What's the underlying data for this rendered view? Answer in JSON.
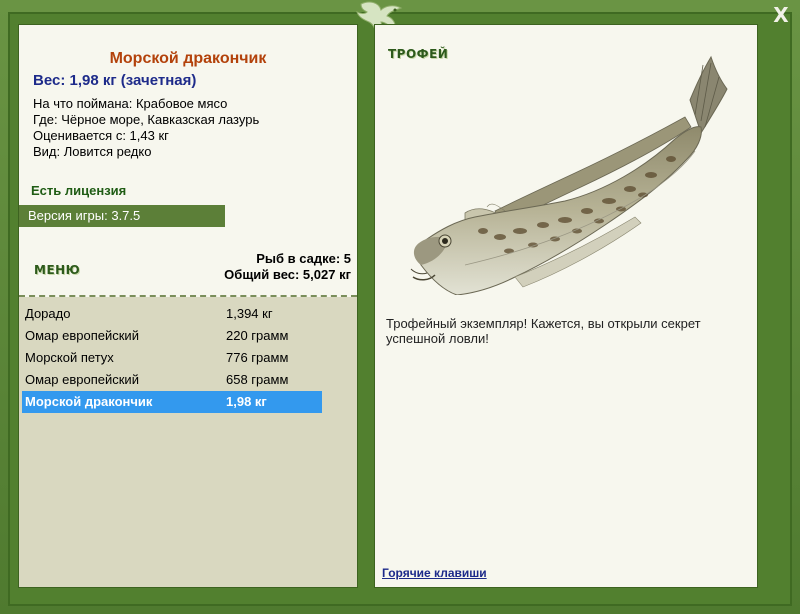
{
  "window": {
    "close_label": "X"
  },
  "fish": {
    "title": "Морской дракончик",
    "weight_line": "Вес: 1,98 кг (зачетная)",
    "bait_line": "На что поймана: Крабовое мясо",
    "location_line": "Где: Чёрное море, Кавказская лазурь",
    "rating_line": "Оценивается с: 1,43 кг",
    "rarity_line": "Вид: Ловится редко"
  },
  "status": {
    "license": "Есть лицензия",
    "version": "Версия игры: 3.7.5"
  },
  "menu": {
    "label": "МЕНЮ"
  },
  "cage": {
    "count_line": "Рыб в садке: 5",
    "total_line": "Общий вес: 5,027 кг"
  },
  "catch_list": [
    {
      "name": "Дорадо",
      "weight": "1,394 кг"
    },
    {
      "name": "Омар европейский",
      "weight": "220 грамм"
    },
    {
      "name": "Морской петух",
      "weight": "776 грамм"
    },
    {
      "name": "Омар европейский",
      "weight": "658 грамм"
    },
    {
      "name": "Морской дракончик",
      "weight": "1,98 кг",
      "selected": true
    }
  ],
  "trophy": {
    "label": "ТРОФЕЙ",
    "description": "Трофейный экземпляр! Кажется, вы открыли секрет успешной ловли!",
    "hotkeys_link": "Горячие клавиши"
  },
  "colors": {
    "frame": "#5f8a3d",
    "title": "#b3420b",
    "selected_row": "#3399ee",
    "version_bar": "#5c7f38"
  }
}
